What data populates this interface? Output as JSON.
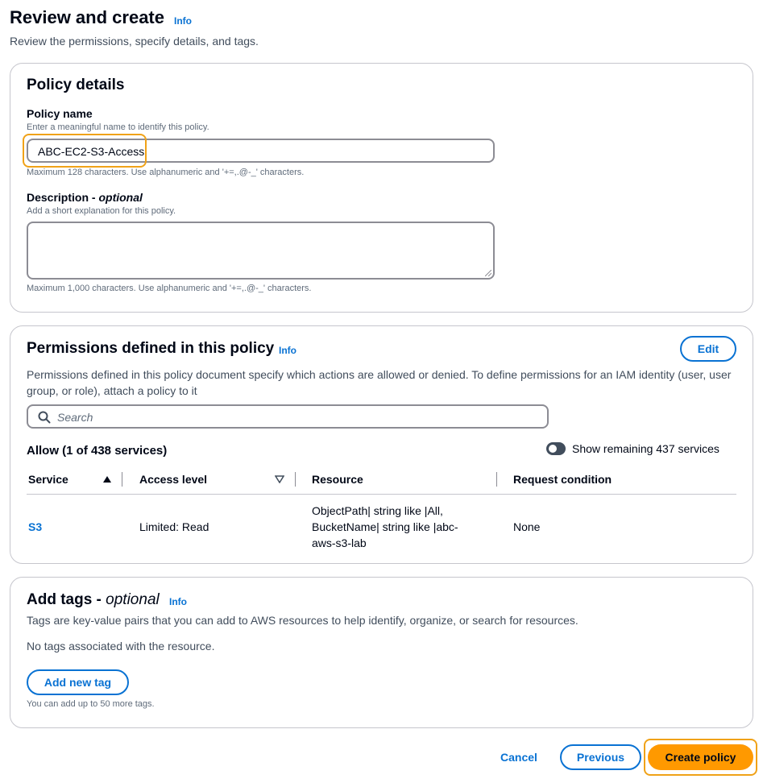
{
  "header": {
    "title": "Review and create",
    "info": "Info",
    "subtitle": "Review the permissions, specify details, and tags."
  },
  "policy_details": {
    "title": "Policy details",
    "name_label": "Policy name",
    "name_hint": "Enter a meaningful name to identify this policy.",
    "name_value": "ABC-EC2-S3-Access",
    "name_constraint": "Maximum 128 characters. Use alphanumeric and '+=,.@-_' characters.",
    "desc_label": "Description - ",
    "desc_label_optional": "optional",
    "desc_hint": "Add a short explanation for this policy.",
    "desc_value": "",
    "desc_constraint": "Maximum 1,000 characters. Use alphanumeric and '+=,.@-_' characters."
  },
  "permissions": {
    "title": "Permissions defined in this policy",
    "info": "Info",
    "edit_label": "Edit",
    "description": "Permissions defined in this policy document specify which actions are allowed or denied. To define permissions for an IAM identity (user, user group, or role), attach a policy to it",
    "search_placeholder": "Search",
    "allow_heading": "Allow (1 of 438 services)",
    "toggle_label": "Show remaining 437 services",
    "toggle_on": false,
    "columns": [
      "Service",
      "Access level",
      "Resource",
      "Request condition"
    ],
    "rows": [
      {
        "service": "S3",
        "access_level": "Limited: Read",
        "resource_lines": [
          "ObjectPath| string like |All,",
          "BucketName| string like |abc-",
          "aws-s3-lab"
        ],
        "request_condition": "None"
      }
    ]
  },
  "tags": {
    "title": "Add tags - ",
    "title_optional": "optional",
    "info": "Info",
    "description": "Tags are key-value pairs that you can add to AWS resources to help identify, organize, or search for resources.",
    "empty_text": "No tags associated with the resource.",
    "add_label": "Add new tag",
    "limit_hint": "You can add up to 50 more tags."
  },
  "footer": {
    "cancel_label": "Cancel",
    "previous_label": "Previous",
    "create_label": "Create policy"
  },
  "colors": {
    "accent": "#0972d3",
    "primary_button": "#ff9900",
    "focus_highlight": "#f0a218"
  },
  "icons": {
    "search": "search-icon",
    "sort_asc": "sort-ascending-icon",
    "sort_desc": "sort-descending-icon"
  }
}
